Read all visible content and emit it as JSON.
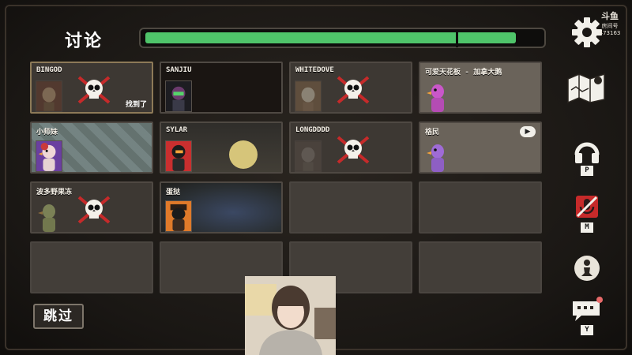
{
  "header": {
    "title": "讨论",
    "timer_progress": 0.94
  },
  "players": [
    {
      "name": "BINGOD",
      "status": "dead",
      "found_label": "找到了"
    },
    {
      "name": "SANJIU",
      "status": "alive"
    },
    {
      "name": "WHITEDOVE",
      "status": "dead"
    },
    {
      "name": "可爱天花板 - 加拿大鹅",
      "status": "alive"
    },
    {
      "name": "小师妹",
      "status": "alive"
    },
    {
      "name": "SYLAR",
      "status": "alive"
    },
    {
      "name": "LONGDDDD",
      "status": "dead"
    },
    {
      "name": "格民",
      "status": "alive"
    },
    {
      "name": "波多野果冻",
      "status": "dead"
    },
    {
      "name": "蛋挞",
      "status": "alive"
    }
  ],
  "empty_slots": 6,
  "controls": {
    "skip_label": "跳过"
  },
  "right_bar": [
    {
      "icon": "settings-gear-icon",
      "key": ""
    },
    {
      "icon": "map-icon",
      "key": ""
    },
    {
      "icon": "headphones-icon",
      "key": "P"
    },
    {
      "icon": "muted-mic-icon",
      "key": "M"
    },
    {
      "icon": "role-pawn-icon",
      "key": ""
    },
    {
      "icon": "chat-icon",
      "key": "Y"
    }
  ],
  "watermark": {
    "logo": "斗鱼",
    "sub": "房间号",
    "room": "473163"
  },
  "colors": {
    "timer": "#4fc46a",
    "kill_x": "#c62a2a",
    "mic_off": "#c62a2a"
  }
}
